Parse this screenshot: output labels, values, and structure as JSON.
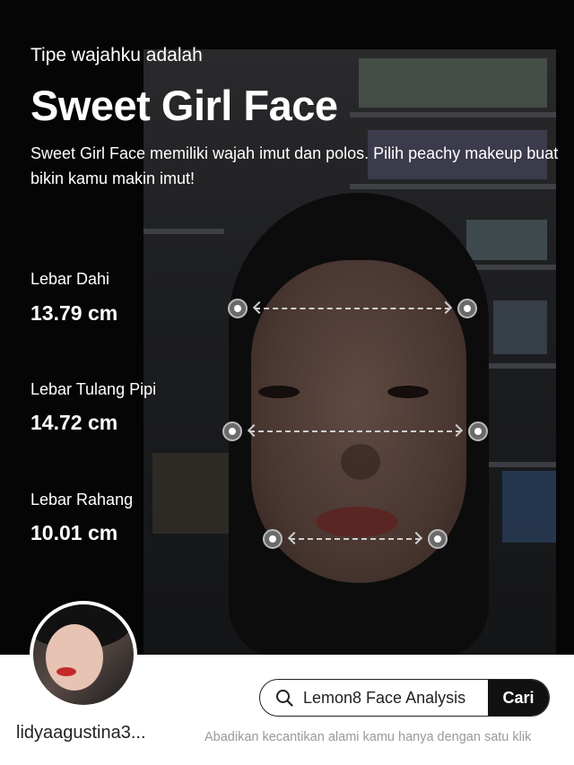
{
  "header": {
    "intro": "Tipe wajahku adalah",
    "title": "Sweet Girl Face",
    "description": "Sweet Girl Face memiliki wajah imut dan polos. Pilih peachy makeup buat bikin kamu makin imut!"
  },
  "metrics": [
    {
      "label": "Lebar Dahi",
      "value": "13.79 cm"
    },
    {
      "label": "Lebar Tulang Pipi",
      "value": "14.72 cm"
    },
    {
      "label": "Lebar Rahang",
      "value": "10.01 cm"
    }
  ],
  "footer": {
    "username": "lidyaagustina3...",
    "search_text": "Lemon8 Face Analysis",
    "search_button": "Cari",
    "tagline": "Abadikan kecantikan alami kamu hanya dengan satu klik"
  },
  "icons": {
    "search": "search-icon",
    "measure_endpoint": "measure-dot-icon"
  },
  "colors": {
    "background": "#000000",
    "footer": "#ffffff",
    "button": "#111111"
  }
}
